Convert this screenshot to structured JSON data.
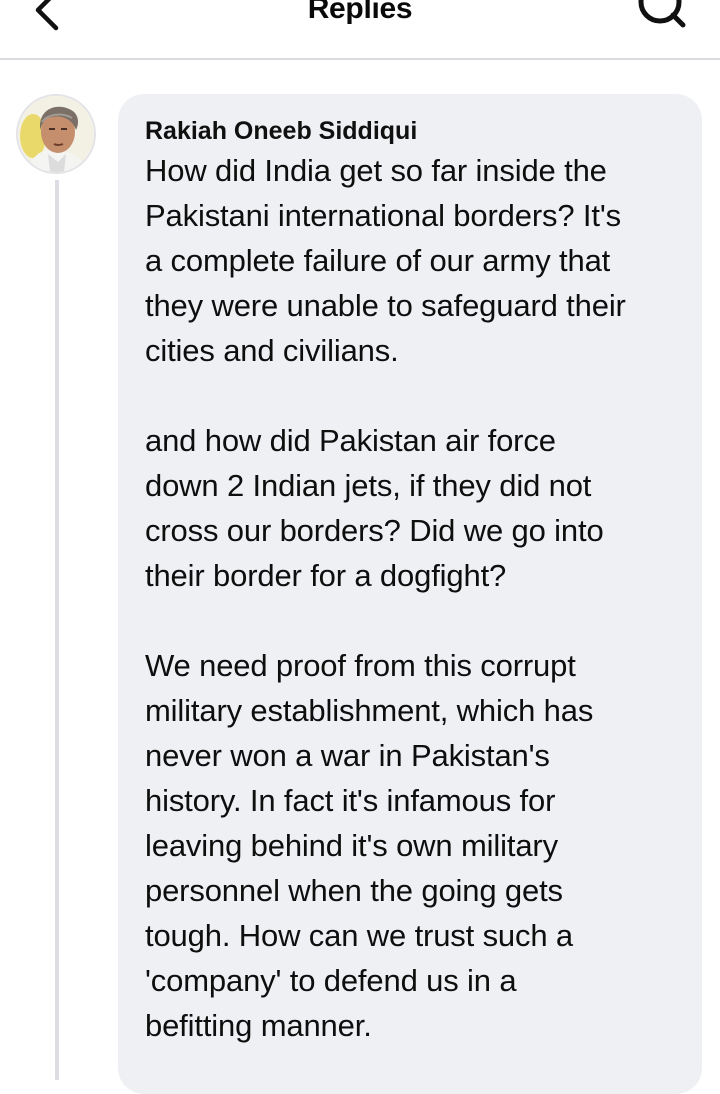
{
  "header": {
    "title": "Replies",
    "back_icon": "chevron-left-icon",
    "search_icon": "search-icon"
  },
  "comment": {
    "author": "Rakiah Oneeb Siddiqui",
    "paragraphs": [
      "How did India get so far inside the\nPakistani international borders? It's\na complete failure of our army that\nthey were unable to safeguard their\ncities and civilians.",
      "and how did  Pakistan air force\ndown 2 Indian jets, if they did not\ncross our borders? Did we go into\ntheir border for a dogfight?",
      "We need proof from this corrupt\nmilitary establishment, which has\nnever won a war in Pakistan's\nhistory. In fact it's infamous for\nleaving behind it's own military\npersonnel when the going gets\ntough. How can we trust such a\n'company' to defend us in a\nbefitting manner."
    ]
  },
  "colors": {
    "bubble_bg": "#eff0f4",
    "divider": "#d9d9de",
    "thread_line": "#dcdce2",
    "text": "#0e0e0e"
  }
}
